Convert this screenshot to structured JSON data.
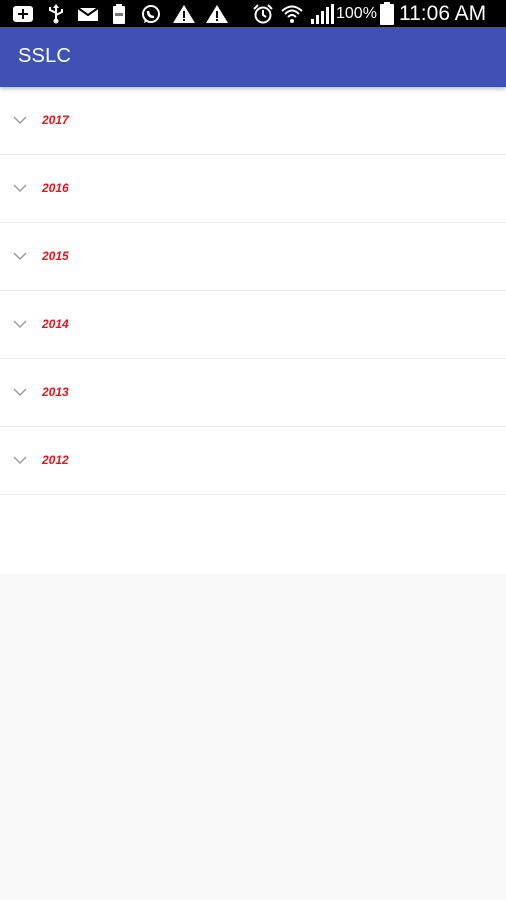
{
  "status_bar": {
    "battery_percent": "100%",
    "time": "11:06 AM",
    "icons": [
      "add-box-icon",
      "usb-icon",
      "mail-icon",
      "battery-saver-icon",
      "whatsapp-icon",
      "warning-icon",
      "warning-icon",
      "alarm-icon",
      "wifi-icon",
      "signal-icon",
      "battery-icon"
    ]
  },
  "app_bar": {
    "title": "SSLC"
  },
  "years": [
    {
      "label": "2017"
    },
    {
      "label": "2016"
    },
    {
      "label": "2015"
    },
    {
      "label": "2014"
    },
    {
      "label": "2013"
    },
    {
      "label": "2012"
    }
  ],
  "colors": {
    "app_bar": "#3f51b5",
    "year_text": "#e8131a",
    "background": "#f9f9f9"
  }
}
